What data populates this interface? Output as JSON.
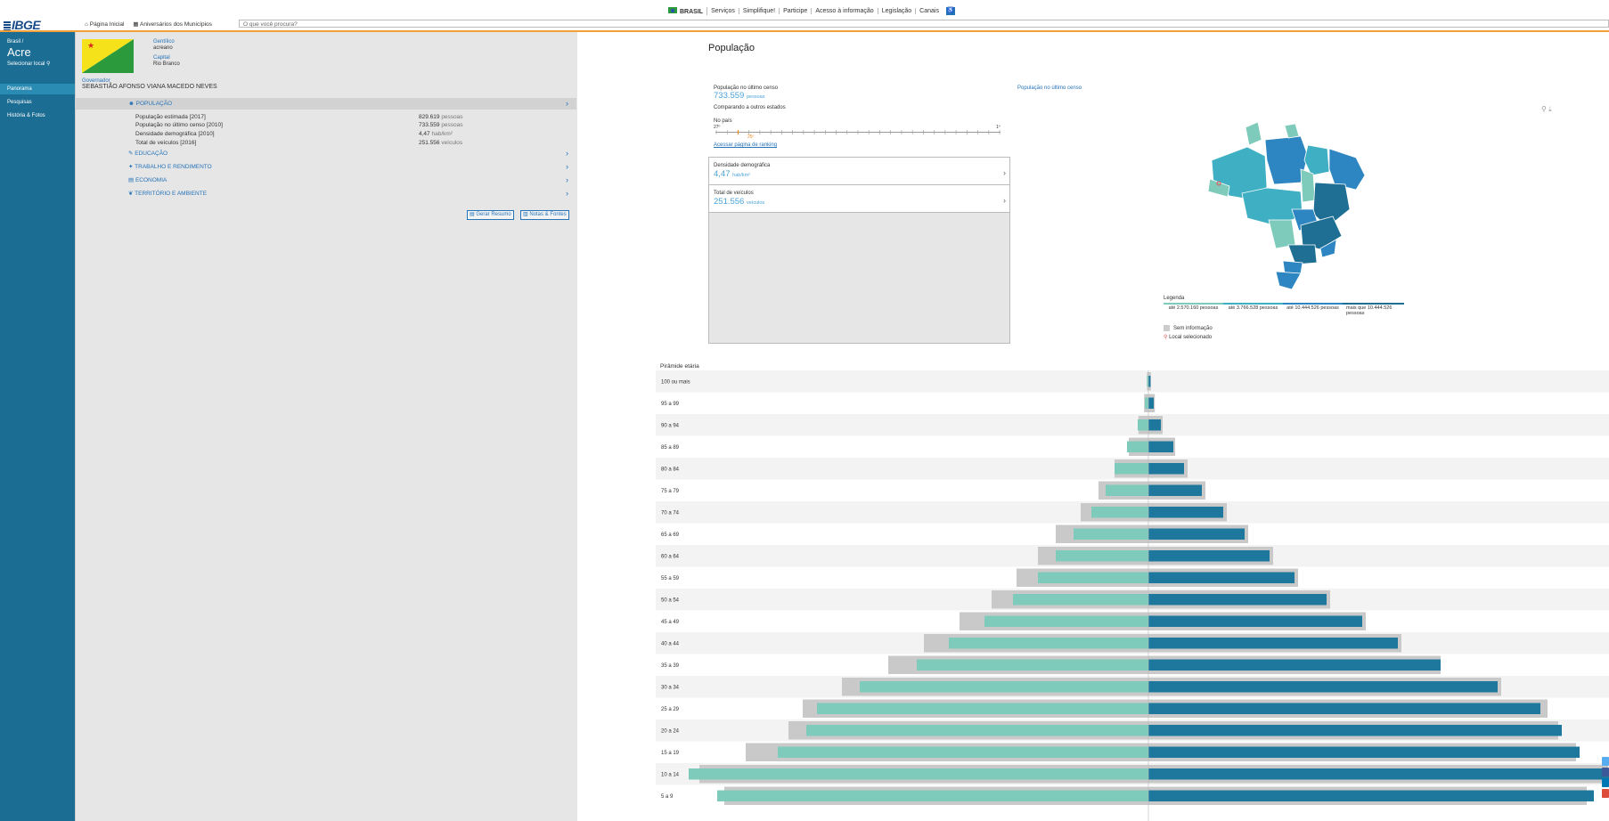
{
  "govbar": {
    "country": "BRASIL",
    "links": [
      "Serviços",
      "Simplifique!",
      "Participe",
      "Acesso à informação",
      "Legislação",
      "Canais"
    ]
  },
  "header": {
    "logo": "IBGE",
    "nav": [
      "Página Inicial",
      "Aniversários dos Municípios"
    ],
    "search_placeholder": "O que você procura?"
  },
  "sidebar": {
    "breadcrumb": "Brasil /",
    "state": "Acre",
    "select_label": "Selecionar local",
    "items": [
      {
        "label": "Panorama",
        "active": true
      },
      {
        "label": "Pesquisas",
        "active": false
      },
      {
        "label": "História & Fotos",
        "active": false
      }
    ]
  },
  "info": {
    "gentilico_label": "Gentílico",
    "gentilico": "acreano",
    "capital_label": "Capital",
    "capital": "Rio Branco",
    "governor_label": "Governador",
    "governor": "SEBASTIÃO AFONSO VIANA MACEDO NEVES"
  },
  "sections": [
    {
      "label": "POPULAÇÃO",
      "expanded": true
    },
    {
      "label": "EDUCAÇÃO",
      "expanded": false
    },
    {
      "label": "TRABALHO E RENDIMENTO",
      "expanded": false
    },
    {
      "label": "ECONOMIA",
      "expanded": false
    },
    {
      "label": "TERRITÓRIO E AMBIENTE",
      "expanded": false
    }
  ],
  "population_rows": [
    {
      "label": "População estimada [2017]",
      "value": "829.619",
      "unit": "pessoas"
    },
    {
      "label": "População no último censo [2010]",
      "value": "733.559",
      "unit": "pessoas"
    },
    {
      "label": "Densidade demográfica [2010]",
      "value": "4,47",
      "unit": "hab/km²"
    },
    {
      "label": "Total de veículos [2016]",
      "value": "251.556",
      "unit": "veículos"
    }
  ],
  "actions": {
    "summary": "Gerar Resumo",
    "notes": "Notas & Fontes"
  },
  "main": {
    "title": "População",
    "census_label": "População no último censo",
    "census_value": "733.559",
    "census_unit": "pessoas",
    "compare_label": "Comparando a outros estados",
    "in_country": "No país",
    "rank_left": "27º",
    "rank_right": "1º",
    "rank_marker": "25º",
    "ranking_link": "Acessar página de ranking",
    "map_title": "População no último censo",
    "cards": [
      {
        "label": "Densidade demográfica",
        "value": "4,47",
        "unit": "hab/km²"
      },
      {
        "label": "Total de veículos",
        "value": "251.556",
        "unit": "veículos"
      }
    ]
  },
  "map_legend": {
    "title": "Legenda",
    "ranges": [
      "até 2.570.160 pessoas",
      "até 3.766.528 pessoas",
      "até 10.444.526 pessoas",
      "mais que 10.444.526 pessoas"
    ],
    "no_info": "Sem informação",
    "selected": "Local selecionado",
    "colors": [
      "#7fcbbb",
      "#3fb0c3",
      "#2d86c1",
      "#1f6f94"
    ]
  },
  "pyramid": {
    "title": "Pirâmide etária",
    "age_groups": [
      "100 ou mais",
      "95 a 99",
      "90 a 94",
      "85 a 89",
      "80 a 84",
      "75 a 79",
      "70 a 74",
      "65 a 69",
      "60 a 64",
      "55 a 59",
      "50 a 54",
      "45 a 49",
      "40 a 44",
      "35 a 39",
      "30 a 34",
      "25 a 29",
      "20 a 24",
      "15 a 19",
      "10 a 14",
      "5 a 9"
    ],
    "colors": {
      "female": "#7fcbbb",
      "male": "#1e789e",
      "brazil": "#c9c9c9"
    }
  },
  "chart_data": {
    "type": "bar",
    "title": "Pirâmide etária",
    "categories": [
      "100 ou mais",
      "95 a 99",
      "90 a 94",
      "85 a 89",
      "80 a 84",
      "75 a 79",
      "70 a 74",
      "65 a 69",
      "60 a 64",
      "55 a 59",
      "50 a 54",
      "45 a 49",
      "40 a 44",
      "35 a 39",
      "30 a 34",
      "25 a 29",
      "20 a 24",
      "15 a 19",
      "10 a 14",
      "5 a 9"
    ],
    "series": [
      {
        "values": [
          0.04,
          0.1,
          0.3,
          0.6,
          0.95,
          1.2,
          1.6,
          2.1,
          2.6,
          3.1,
          3.8,
          4.6,
          5.6,
          6.5,
          8.1,
          9.3,
          9.6,
          10.4,
          12.9,
          12.1
        ]
      },
      {
        "values": [
          0.06,
          0.15,
          0.35,
          0.7,
          1.0,
          1.5,
          2.1,
          2.7,
          3.4,
          4.1,
          5.0,
          6.0,
          7.0,
          8.2,
          9.8,
          11.0,
          11.6,
          12.1,
          13.0,
          12.5
        ]
      },
      {
        "values": [
          0.04,
          0.12,
          0.28,
          0.55,
          0.95,
          1.4,
          1.9,
          2.6,
          3.1,
          3.7,
          4.4,
          5.3,
          6.3,
          7.3,
          8.6,
          9.7,
          10.1,
          11.3,
          12.6,
          11.9
        ]
      },
      {
        "values": [
          0.07,
          0.18,
          0.4,
          0.75,
          1.1,
          1.6,
          2.2,
          2.8,
          3.5,
          4.2,
          5.1,
          6.1,
          7.1,
          8.2,
          9.9,
          11.2,
          11.5,
          12.0,
          12.9,
          12.3
        ]
      }
    ]
  },
  "share": {
    "icons": [
      "twitter-icon",
      "facebook-icon",
      "linkedin-icon",
      "googleplus-icon"
    ]
  }
}
